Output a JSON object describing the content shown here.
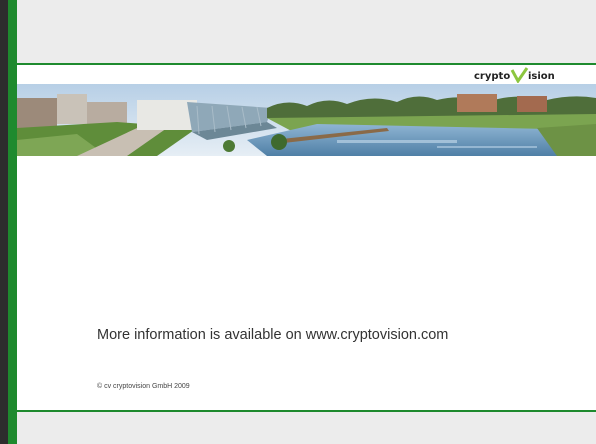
{
  "logo": {
    "text_left": "crypto",
    "text_right": "ision",
    "icon": "v-checkmark-icon"
  },
  "banner": {
    "icon": "campus-panorama-photo"
  },
  "body": {
    "info_text": "More information is available on www.cryptovision.com"
  },
  "footer": {
    "copyright": "© cv cryptovision GmbH 2009"
  },
  "colors": {
    "accent_green": "#1e8a2e",
    "band_gray": "#ececec",
    "text": "#333333"
  }
}
